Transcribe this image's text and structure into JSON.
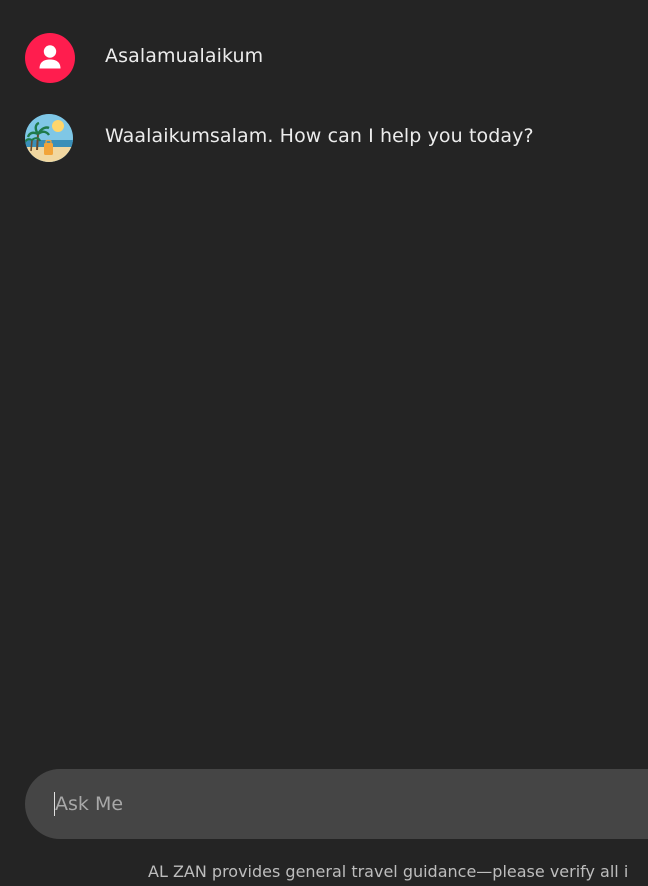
{
  "messages": [
    {
      "role": "user",
      "text": "Asalamualaikum",
      "avatar_icon": "user-icon",
      "avatar_color": "#ff1d4e"
    },
    {
      "role": "assistant",
      "text": "Waalaikumsalam. How can I help you today?",
      "avatar_icon": "beach-travel-icon"
    }
  ],
  "input": {
    "placeholder": "Ask Me",
    "value": ""
  },
  "footer": {
    "disclaimer": "AL ZAN provides general travel guidance—please verify all i"
  },
  "colors": {
    "background": "#242424",
    "input_background": "#454545",
    "accent": "#ff1d4e",
    "text": "#ececec"
  }
}
